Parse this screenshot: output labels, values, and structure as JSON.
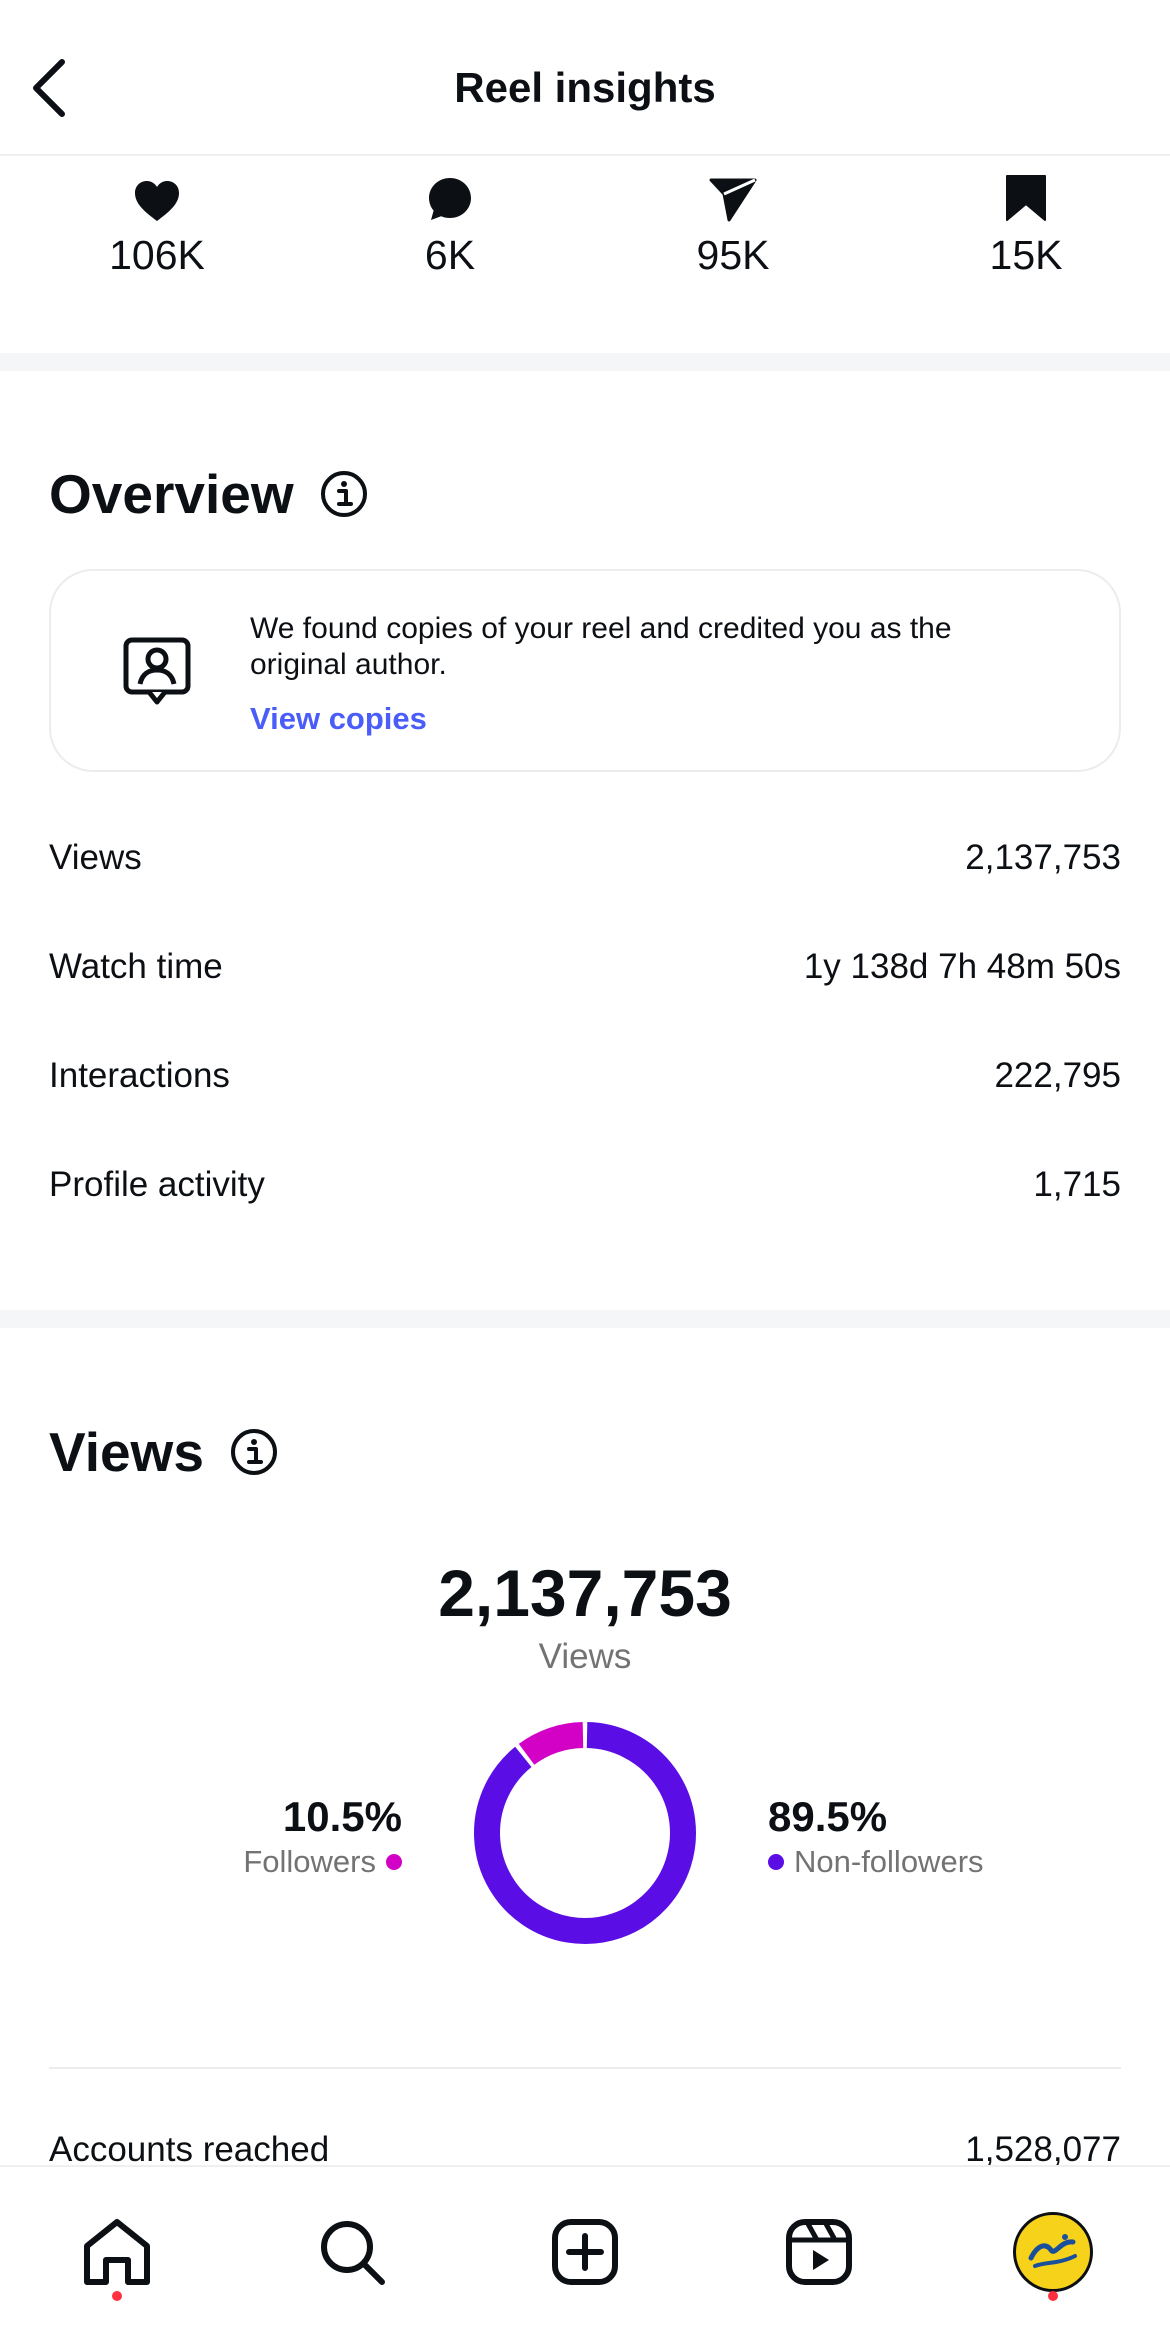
{
  "header": {
    "title": "Reel insights"
  },
  "stats": [
    {
      "icon": "heart-icon",
      "value": "106K"
    },
    {
      "icon": "comment-icon",
      "value": "6K"
    },
    {
      "icon": "share-icon",
      "value": "95K"
    },
    {
      "icon": "bookmark-icon",
      "value": "15K"
    }
  ],
  "overview": {
    "title": "Overview",
    "card_text": "We found copies of your reel and credited you as the original author.",
    "card_link": "View copies",
    "metrics": [
      {
        "label": "Views",
        "value": "2,137,753"
      },
      {
        "label": "Watch time",
        "value": "1y 138d 7h 48m 50s"
      },
      {
        "label": "Interactions",
        "value": "222,795"
      },
      {
        "label": "Profile activity",
        "value": "1,715"
      }
    ]
  },
  "views": {
    "title": "Views",
    "total": "2,137,753",
    "total_label": "Views",
    "followers_pct": "10.5%",
    "followers_label": "Followers",
    "nonfollowers_pct": "89.5%",
    "nonfollowers_label": "Non-followers",
    "colors": {
      "followers": "#d300c5",
      "nonfollowers": "#5b0de5"
    },
    "accounts_reached_label": "Accounts reached",
    "accounts_reached_value": "1,528,077"
  },
  "chart_data": {
    "type": "pie",
    "categories": [
      "Followers",
      "Non-followers"
    ],
    "values": [
      10.5,
      89.5
    ]
  },
  "nav": [
    "home-icon",
    "search-icon",
    "create-icon",
    "reels-icon",
    "profile-avatar"
  ]
}
